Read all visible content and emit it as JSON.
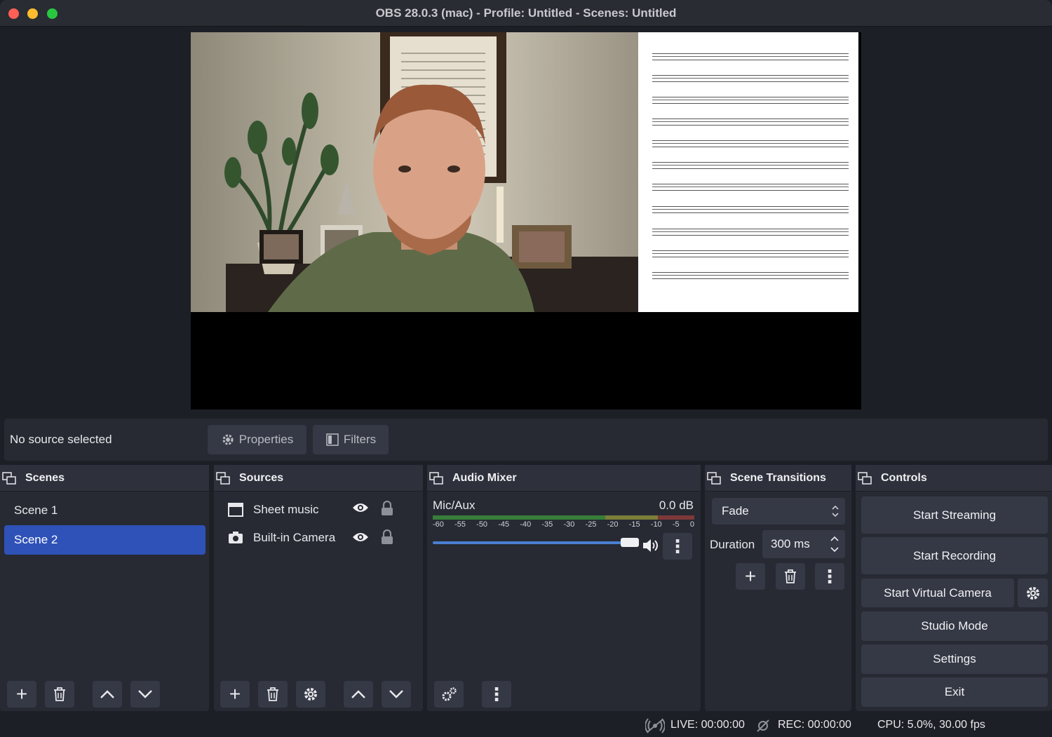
{
  "window": {
    "title": "OBS 28.0.3 (mac) - Profile: Untitled - Scenes: Untitled"
  },
  "props_bar": {
    "no_source": "No source selected",
    "properties_label": "Properties",
    "filters_label": "Filters"
  },
  "scenes": {
    "title": "Scenes",
    "items": [
      {
        "label": "Scene 1",
        "selected": false
      },
      {
        "label": "Scene 2",
        "selected": true
      }
    ]
  },
  "sources": {
    "title": "Sources",
    "items": [
      {
        "label": "Sheet music",
        "icon": "window-icon"
      },
      {
        "label": "Built-in Camera",
        "icon": "camera-icon"
      }
    ]
  },
  "audio": {
    "title": "Audio Mixer",
    "channel": "Mic/Aux",
    "level": "0.0 dB",
    "ticks": [
      "-60",
      "-55",
      "-50",
      "-45",
      "-40",
      "-35",
      "-30",
      "-25",
      "-20",
      "-15",
      "-10",
      "-5",
      "0"
    ],
    "volume": 1.0
  },
  "transitions": {
    "title": "Scene Transitions",
    "selected": "Fade",
    "duration_label": "Duration",
    "duration_value": "300 ms"
  },
  "controls": {
    "title": "Controls",
    "start_streaming": "Start Streaming",
    "start_recording": "Start Recording",
    "start_virtual_camera": "Start Virtual Camera",
    "studio_mode": "Studio Mode",
    "settings": "Settings",
    "exit": "Exit"
  },
  "status": {
    "live": "LIVE: 00:00:00",
    "rec": "REC: 00:00:00",
    "cpu": "CPU: 5.0%, 30.00 fps"
  },
  "colors": {
    "accent": "#2f52b8",
    "panel": "#272a33",
    "button": "#353945"
  }
}
